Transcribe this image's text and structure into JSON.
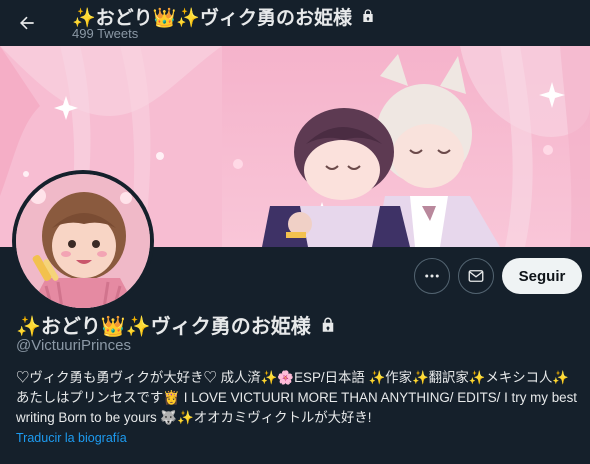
{
  "header": {
    "title": "✨おどり👑✨ヴィク勇のお姫様",
    "tweet_count": "499 Tweets"
  },
  "profile": {
    "display_name": "✨おどり👑✨ヴィク勇のお姫様",
    "handle": "@VictuuriPrinces",
    "bio": "♡ヴィク勇も勇ヴィクが大好き♡ 成人済✨🌸ESP/日本語 ✨作家✨翻訳家✨メキシコ人✨あたしはプリンセスです👸 I LOVE VICTUURI MORE THAN ANYTHING/ EDITS/ I try my best writing Born to be yours 🐺✨オオカミヴィクトルが大好き!",
    "translate_link": "Traducir la biografía",
    "locked": true
  },
  "actions": {
    "more_icon": "more-icon",
    "message_icon": "envelope-icon",
    "follow_label": "Seguir"
  },
  "colors": {
    "background": "#15202b",
    "text_primary": "#e7e9ea",
    "text_secondary": "#8b98a5",
    "link": "#1d9bf0",
    "follow_button_bg": "#eff3f4",
    "banner_pink": "#f6b8cf"
  }
}
